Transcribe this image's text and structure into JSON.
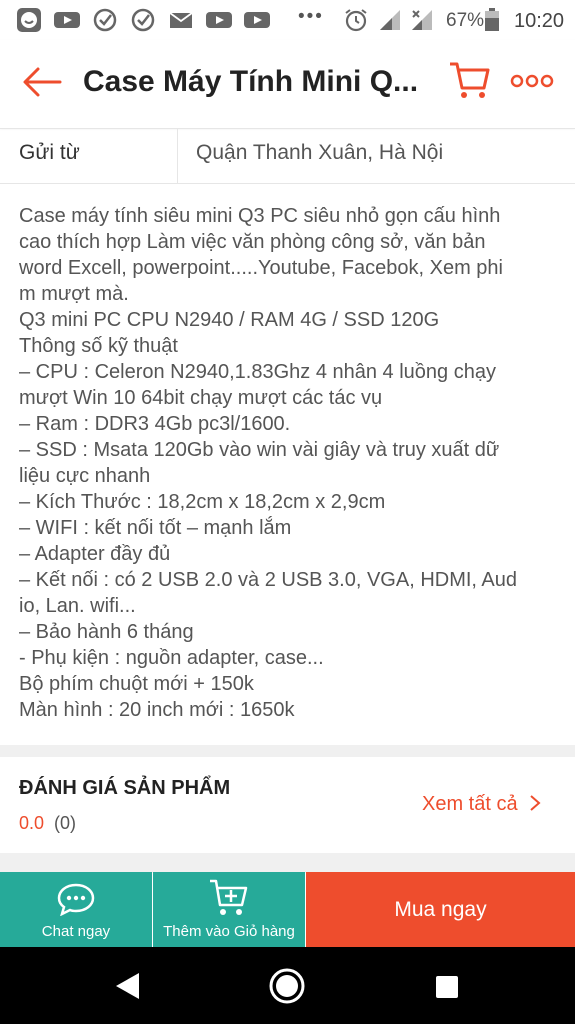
{
  "status_bar": {
    "battery": "67%",
    "time": "10:20",
    "more": "•••"
  },
  "app_bar": {
    "title": "Case Máy Tính Mini Q..."
  },
  "location": {
    "label": "Gửi từ",
    "value": "Quận Thanh Xuân, Hà Nội"
  },
  "description": [
    "Case máy tính siêu mini Q3 PC siêu nhỏ gọn cấu hình",
    "cao thích hợp Làm việc văn phòng công sở, văn bản",
    "word Excell, powerpoint.....Youtube, Facebok, Xem phi",
    "m mượt mà.",
    "Q3 mini PC CPU N2940 / RAM 4G / SSD 120G",
    "Thông số kỹ thuật",
    "– CPU : Celeron N2940,1.83Ghz 4 nhân 4 luồng chạy",
    "mượt Win 10 64bit chạy mượt các tác vụ",
    "– Ram : DDR3 4Gb pc3l/1600.",
    "– SSD : Msata 120Gb vào win vài giây và truy xuất dữ",
    "liệu cực nhanh",
    "– Kích Thước : 18,2cm x 18,2cm x 2,9cm",
    "– WIFI : kết nối tốt – mạnh lắm",
    "– Adapter đầy đủ",
    "– Kết nối : có 2 USB 2.0 và 2 USB 3.0, VGA, HDMI, Aud",
    "io, Lan. wifi...",
    "– Bảo hành 6 tháng",
    "- Phụ kiện : nguồn adapter, case...",
    "Bộ phím chuột mới  + 150k",
    "Màn hình : 20 inch mới : 1650k"
  ],
  "rating": {
    "title": "ĐÁNH GIÁ SẢN PHẨM",
    "score": "0.0",
    "count": "(0)",
    "see_all": "Xem tất cả"
  },
  "bottom_bar": {
    "chat_label": "Chat ngay",
    "cart_label": "Thêm vào Giỏ hàng",
    "buy_label": "Mua ngay"
  },
  "colors": {
    "accent": "#ee4d2d",
    "teal": "#26aa99"
  }
}
